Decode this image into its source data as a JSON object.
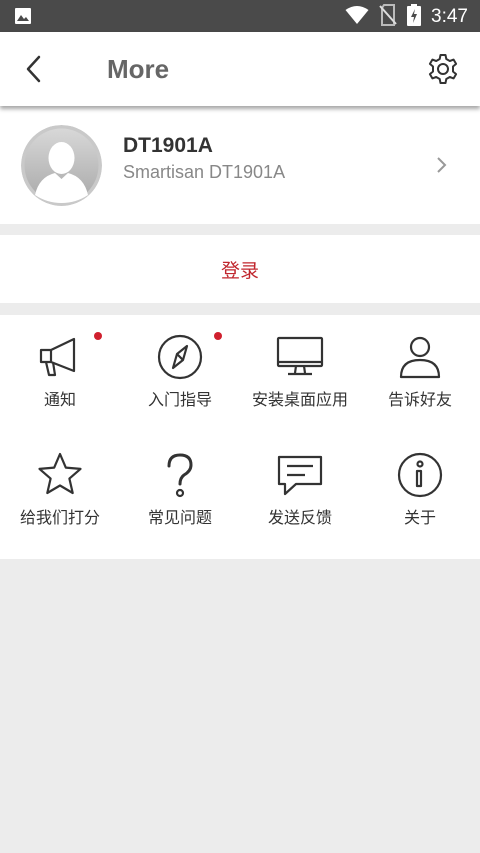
{
  "status_bar": {
    "time": "3:47"
  },
  "header": {
    "title": "More"
  },
  "profile": {
    "name": "DT1901A",
    "model": "Smartisan DT1901A"
  },
  "login": {
    "label": "登录"
  },
  "accent_color": "#c0262d",
  "menu": [
    {
      "label": "通知",
      "icon": "megaphone-icon",
      "badge": true
    },
    {
      "label": "入门指导",
      "icon": "compass-icon",
      "badge": true
    },
    {
      "label": "安装桌面应用",
      "icon": "monitor-icon",
      "badge": false
    },
    {
      "label": "告诉好友",
      "icon": "person-icon",
      "badge": false
    },
    {
      "label": "给我们打分",
      "icon": "star-icon",
      "badge": false
    },
    {
      "label": "常见问题",
      "icon": "question-icon",
      "badge": false
    },
    {
      "label": "发送反馈",
      "icon": "message-icon",
      "badge": false
    },
    {
      "label": "关于",
      "icon": "info-icon",
      "badge": false
    }
  ]
}
